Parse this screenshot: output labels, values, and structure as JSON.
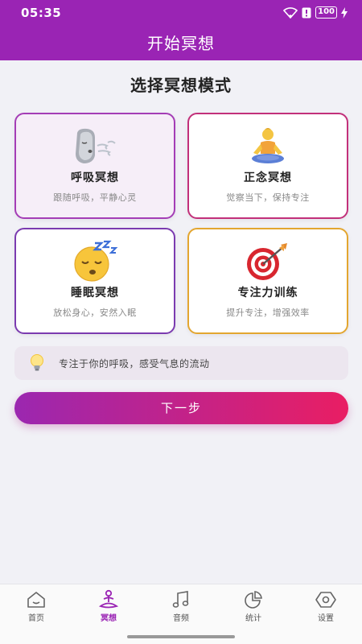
{
  "status_bar": {
    "time": "05:35",
    "battery": "100"
  },
  "header": {
    "title": "开始冥想"
  },
  "main": {
    "section_title": "选择冥想模式",
    "modes": [
      {
        "title": "呼吸冥想",
        "subtitle": "跟随呼吸，平静心灵",
        "icon": "breathing-face-icon",
        "border_color": "#a43db6",
        "selected": true
      },
      {
        "title": "正念冥想",
        "subtitle": "觉察当下，保持专注",
        "icon": "lotus-person-icon",
        "border_color": "#c2307a",
        "selected": false
      },
      {
        "title": "睡眠冥想",
        "subtitle": "放松身心，安然入眠",
        "icon": "sleeping-face-icon",
        "border_color": "#7b3bb0",
        "selected": false
      },
      {
        "title": "专注力训练",
        "subtitle": "提升专注，增强效率",
        "icon": "target-dart-icon",
        "border_color": "#e3a630",
        "selected": false
      }
    ],
    "tip": {
      "icon": "lightbulb-icon",
      "text": "专注于你的呼吸，感受气息的流动"
    },
    "next_button": "下一步"
  },
  "tab_bar": {
    "items": [
      {
        "label": "首页",
        "icon": "home-icon",
        "active": false
      },
      {
        "label": "冥想",
        "icon": "meditation-icon",
        "active": true
      },
      {
        "label": "音频",
        "icon": "music-note-icon",
        "active": false
      },
      {
        "label": "统计",
        "icon": "pie-chart-icon",
        "active": false
      },
      {
        "label": "设置",
        "icon": "settings-hexagon-icon",
        "active": false
      }
    ]
  },
  "colors": {
    "header_bg": "#9a24b4",
    "accent": "#9a24b4",
    "button_gradient_start": "#9b27b0",
    "button_gradient_end": "#e91e63"
  }
}
